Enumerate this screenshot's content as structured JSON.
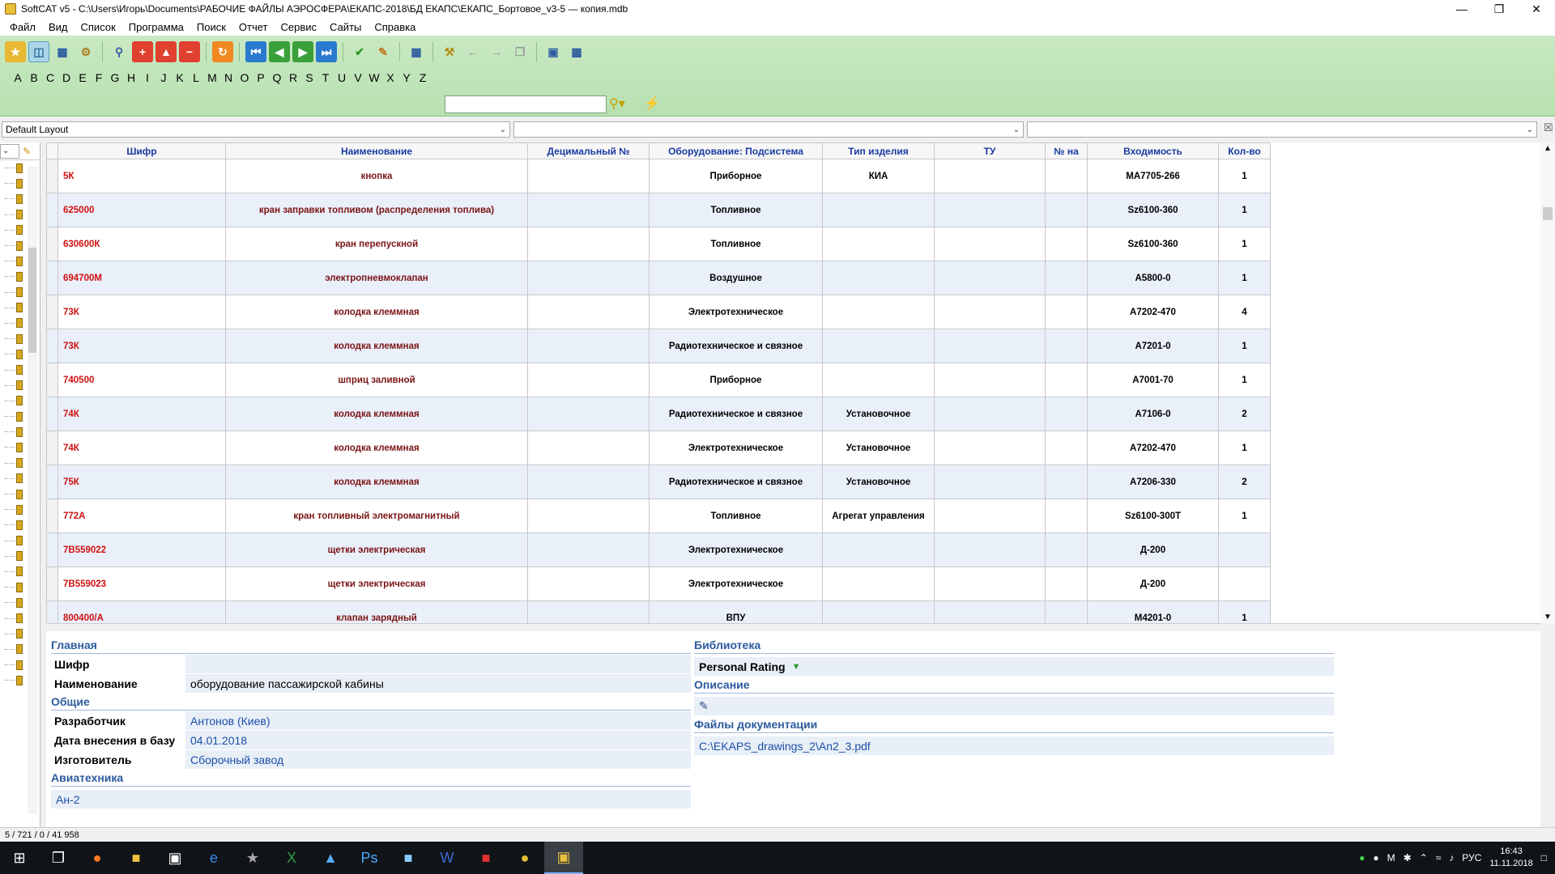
{
  "window": {
    "title": "SoftCAT v5 - C:\\Users\\Игорь\\Documents\\РАБОЧИЕ ФАЙЛЫ АЭРОСФЕРА\\ЕКАПС-2018\\БД ЕКАПС\\ЕКАПС_Бортовое_v3-5 — копия.mdb",
    "minimize": "—",
    "maximize": "❐",
    "close": "✕"
  },
  "menu": [
    "Файл",
    "Вид",
    "Список",
    "Программа",
    "Поиск",
    "Отчет",
    "Сервис",
    "Сайты",
    "Справка"
  ],
  "alphabet": [
    "A",
    "B",
    "C",
    "D",
    "E",
    "F",
    "G",
    "H",
    "I",
    "J",
    "K",
    "L",
    "M",
    "N",
    "O",
    "P",
    "Q",
    "R",
    "S",
    "T",
    "U",
    "V",
    "W",
    "X",
    "Y",
    "Z"
  ],
  "search": {
    "value": "",
    "placeholder": ""
  },
  "layout": {
    "selected": "Default Layout"
  },
  "grid": {
    "columns": [
      "Шифр",
      "Наименование",
      "Децимальный №",
      "Оборудование: Подсистема",
      "Тип изделия",
      "ТУ",
      "№ на",
      "Входимость",
      "Кол-во"
    ],
    "rows": [
      [
        "5К",
        "кнопка",
        "",
        "Приборное",
        "КИА",
        "",
        "",
        "MA7705-266",
        "1"
      ],
      [
        "625000",
        "кран заправки топливом (распределения топлива)",
        "",
        "Топливное",
        "",
        "",
        "",
        "Sz6100-360",
        "1"
      ],
      [
        "630600К",
        "кран перепускной",
        "",
        "Топливное",
        "",
        "",
        "",
        "Sz6100-360",
        "1"
      ],
      [
        "694700М",
        "электропневмоклапан",
        "",
        "Воздушное",
        "",
        "",
        "",
        "A5800-0",
        "1"
      ],
      [
        "73К",
        "колодка клеммная",
        "",
        "Электротехническое",
        "",
        "",
        "",
        "A7202-470",
        "4"
      ],
      [
        "73К",
        "колодка клеммная",
        "",
        "Радиотехническое и связное",
        "",
        "",
        "",
        "A7201-0",
        "1"
      ],
      [
        "740500",
        "шприц заливной",
        "",
        "Приборное",
        "",
        "",
        "",
        "A7001-70",
        "1"
      ],
      [
        "74К",
        "колодка клеммная",
        "",
        "Радиотехническое и связное",
        "Установочное",
        "",
        "",
        "A7106-0",
        "2"
      ],
      [
        "74К",
        "колодка клеммная",
        "",
        "Электротехническое",
        "Установочное",
        "",
        "",
        "A7202-470",
        "1"
      ],
      [
        "75К",
        "колодка клеммная",
        "",
        "Радиотехническое и связное",
        "Установочное",
        "",
        "",
        "A7206-330",
        "2"
      ],
      [
        "772А",
        "кран топливный электромагнитный",
        "",
        "Топливное",
        "Агрегат управления",
        "",
        "",
        "Sz6100-300T",
        "1"
      ],
      [
        "7В559022",
        "щетки электрическая",
        "",
        "Электротехническое",
        "",
        "",
        "",
        "Д-200",
        ""
      ],
      [
        "7В559023",
        "щетки электрическая",
        "",
        "Электротехническое",
        "",
        "",
        "",
        "Д-200",
        ""
      ],
      [
        "800400/А",
        "клапан зарядный",
        "",
        "ВПУ",
        "",
        "",
        "",
        "M4201-0",
        "1"
      ]
    ]
  },
  "detail": {
    "main_title": "Главная",
    "code_label": "Шифр",
    "code_value": "",
    "name_label": "Наименование",
    "name_value": "оборудование пассажирской кабины",
    "general_title": "Общие",
    "developer_label": "Разработчик",
    "developer_value": "Антонов (Киев)",
    "date_label": "Дата внесения в базу",
    "date_value": "04.01.2018",
    "maker_label": "Изготовитель",
    "maker_value": "Сборочный завод",
    "aviation_title": "Авиатехника",
    "aviation_value": "Ан-2",
    "library_title": "Библиотека",
    "rating_value": "Personal Rating",
    "description_title": "Описание",
    "docs_title": "Файлы документации",
    "docs_value": "C:\\EKAPS_drawings_2\\An2_3.pdf"
  },
  "status": {
    "text": "5 / 721 / 0 / 41 958"
  },
  "tray": {
    "lang": "РУС",
    "time": "16:43",
    "date": "11.11.2018"
  }
}
